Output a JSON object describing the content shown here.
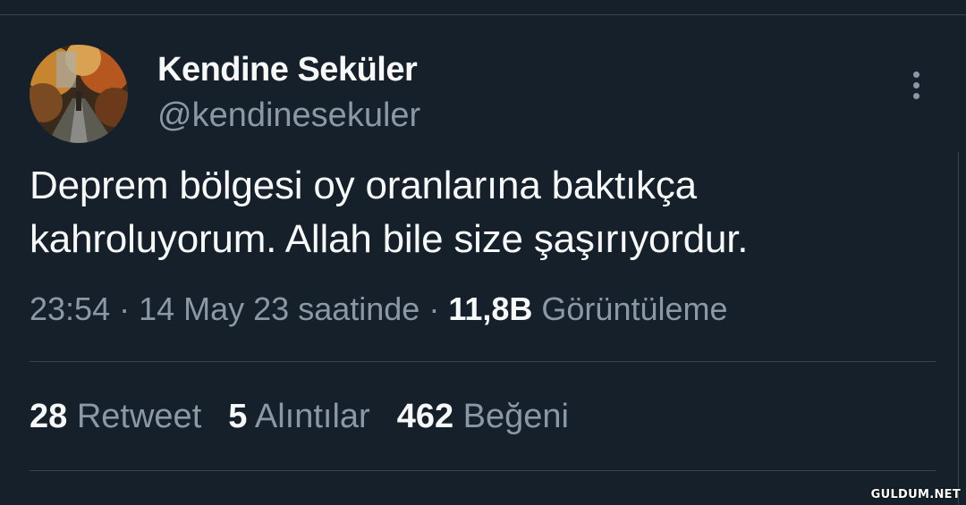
{
  "tweet": {
    "author": {
      "display_name": "Kendine Seküler",
      "handle": "@kendinesekuler",
      "avatar_icon": "profile-photo-autumn-path"
    },
    "text_lines": [
      "Deprem bölgesi oy oranlarına baktıkça",
      "kahroluyorum. Allah bile size şaşırıyordur."
    ],
    "meta": {
      "time": "23:54",
      "separator": " · ",
      "date": "14 May 23 saatinde",
      "views_count": "11,8B",
      "views_label": "Görüntüleme"
    },
    "stats": {
      "retweets_count": "28",
      "retweets_label": "Retweet",
      "quotes_count": "5",
      "quotes_label": "Alıntılar",
      "likes_count": "462",
      "likes_label": "Beğeni"
    },
    "more_icon": "more-vertical-icon"
  },
  "watermark": "GULDUM.NET",
  "colors": {
    "background": "#15202b",
    "primary_text": "#f7f9f9",
    "secondary_text": "#8b98a5",
    "divider": "#38444d"
  }
}
